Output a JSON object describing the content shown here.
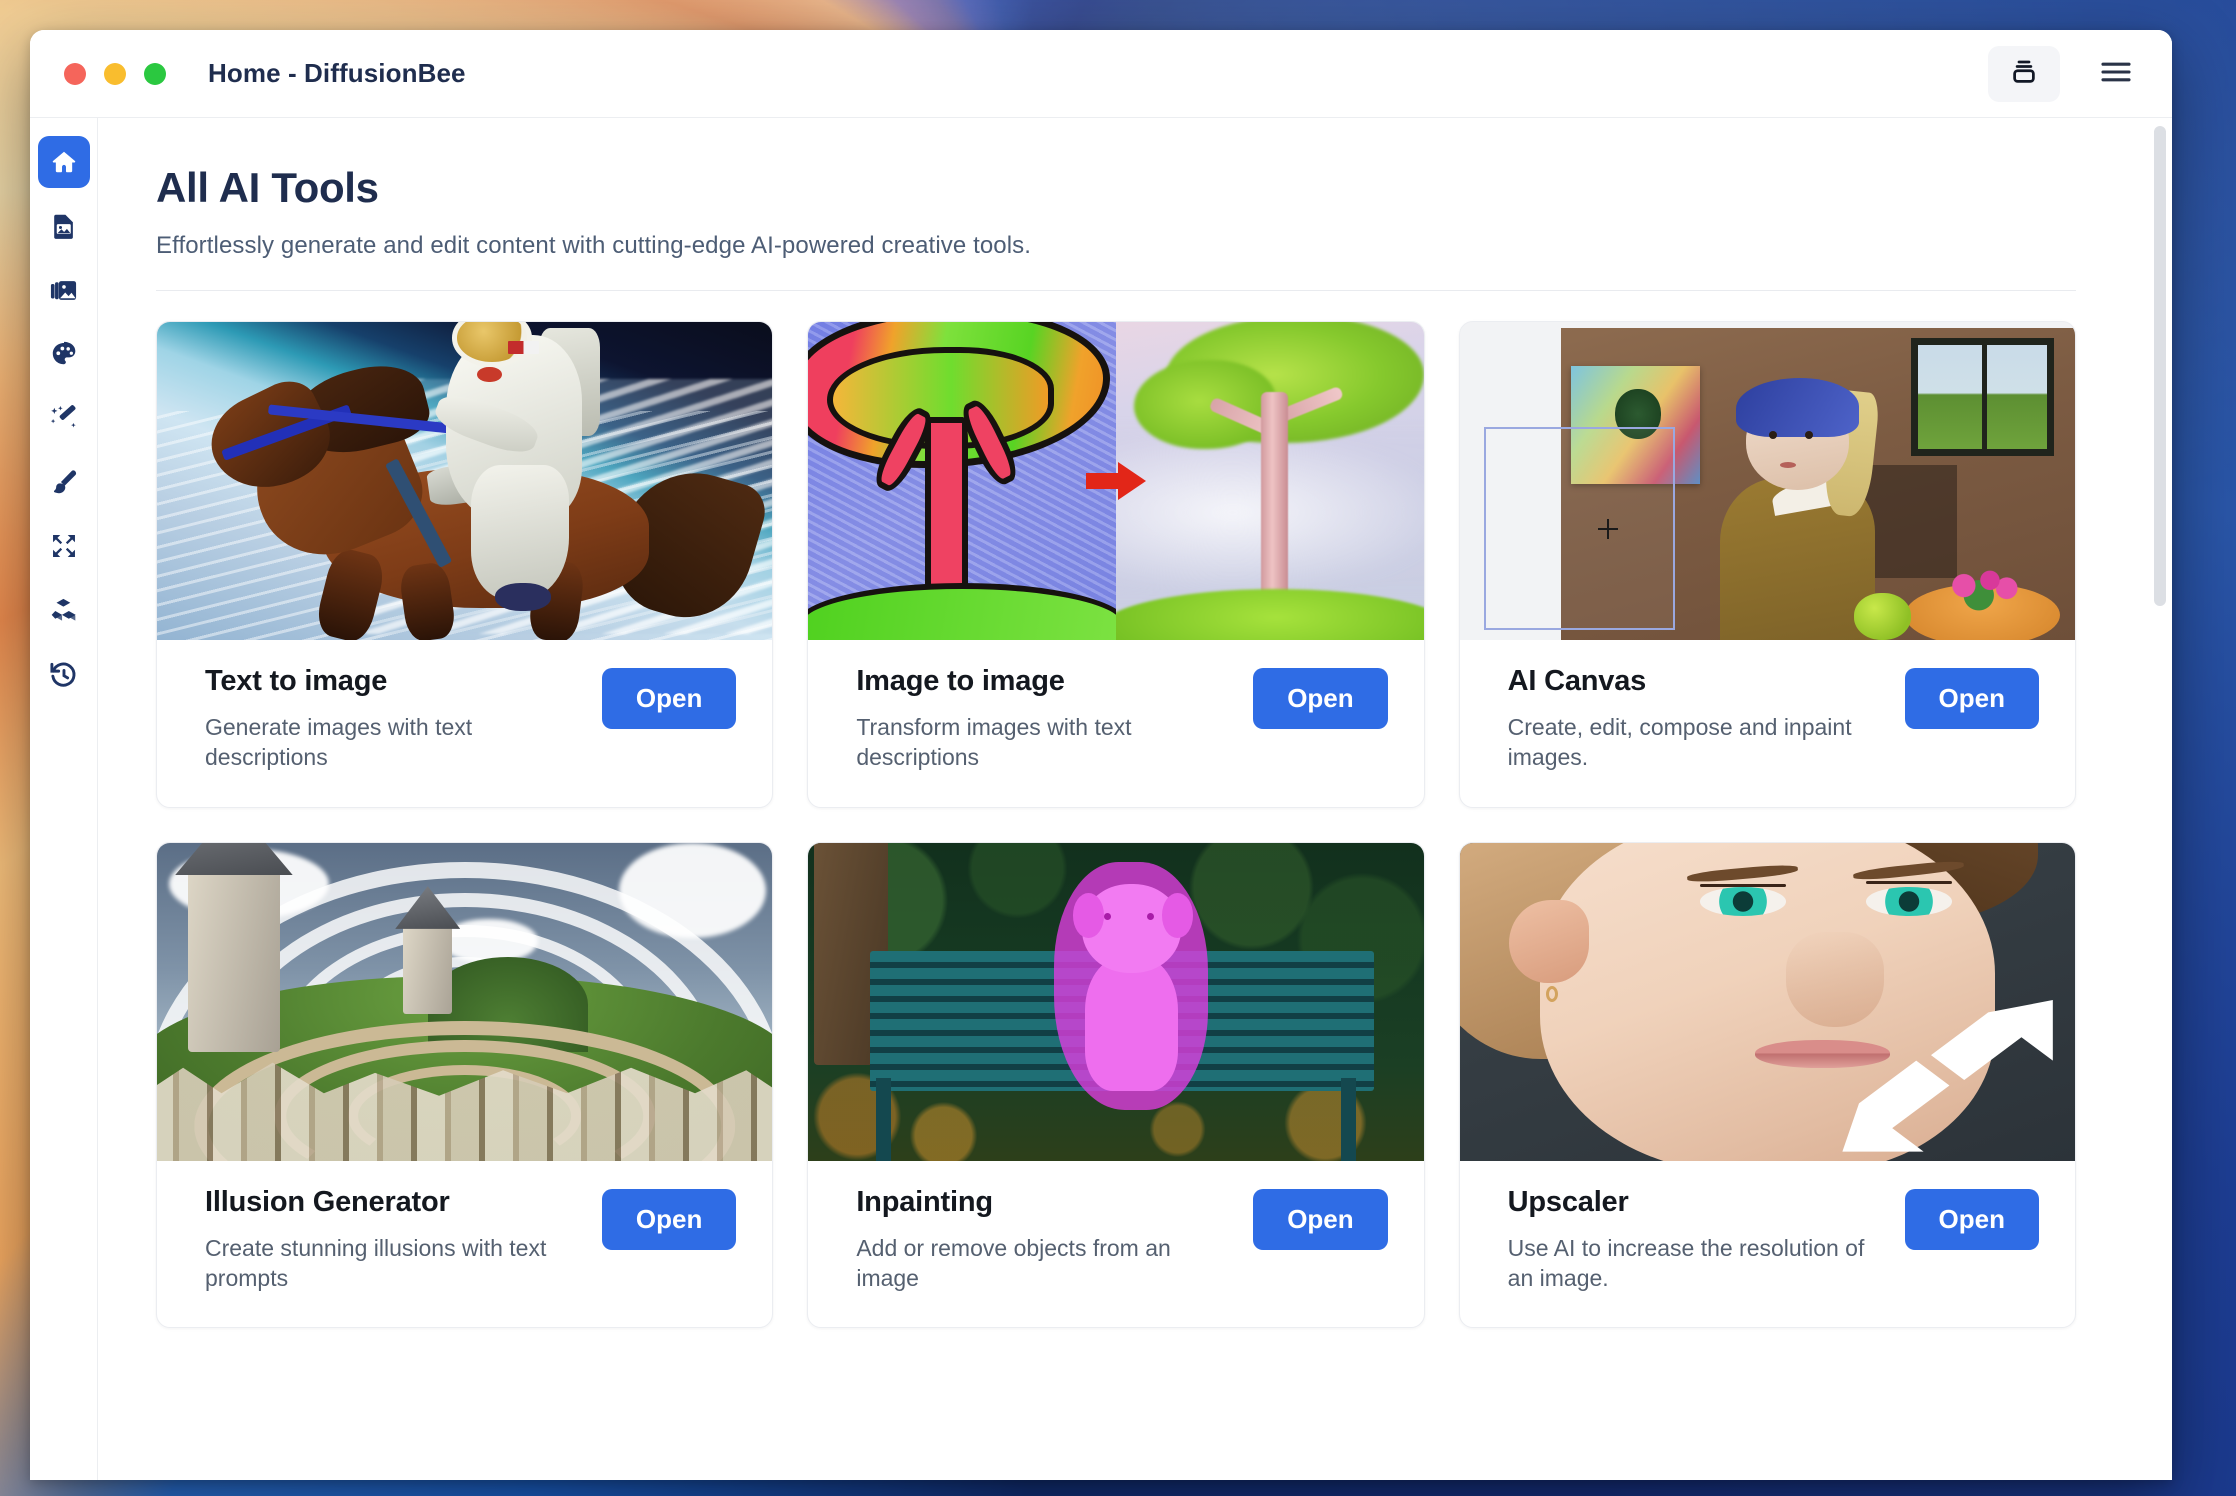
{
  "window": {
    "title": "Home - DiffusionBee",
    "traffic_lights": [
      "close",
      "minimize",
      "maximize"
    ],
    "layers_button_icon": "layers-stack-icon",
    "menu_button_icon": "hamburger-menu-icon"
  },
  "sidebar": {
    "items": [
      {
        "name": "home",
        "icon": "home-icon",
        "active": true
      },
      {
        "name": "text-to-image",
        "icon": "image-file-icon",
        "active": false
      },
      {
        "name": "gallery",
        "icon": "images-stack-icon",
        "active": false
      },
      {
        "name": "styles",
        "icon": "palette-icon",
        "active": false
      },
      {
        "name": "magic-edit",
        "icon": "magic-wand-icon",
        "active": false
      },
      {
        "name": "paint",
        "icon": "paintbrush-icon",
        "active": false
      },
      {
        "name": "upscale",
        "icon": "expand-arrows-icon",
        "active": false
      },
      {
        "name": "models",
        "icon": "blocks-cubes-icon",
        "active": false
      },
      {
        "name": "history",
        "icon": "history-clock-icon",
        "active": false
      }
    ]
  },
  "page": {
    "title": "All AI Tools",
    "subtitle": "Effortlessly generate and edit content with cutting-edge AI-powered creative tools."
  },
  "cards": [
    {
      "title": "Text to image",
      "description": "Generate images with text descriptions",
      "button_label": "Open",
      "thumbnail": "astronaut-riding-horse-in-space"
    },
    {
      "title": "Image to image",
      "description": "Transform images with text descriptions",
      "button_label": "Open",
      "thumbnail": "crayon-tree-to-realistic-tree"
    },
    {
      "title": "AI Canvas",
      "description": "Create, edit, compose and inpaint images.",
      "button_label": "Open",
      "thumbnail": "girl-with-pearl-earring-canvas"
    },
    {
      "title": "Illusion Generator",
      "description": "Create stunning illusions with text prompts",
      "button_label": "Open",
      "thumbnail": "spiral-medieval-village"
    },
    {
      "title": "Inpainting",
      "description": "Add or remove objects from an image",
      "button_label": "Open",
      "thumbnail": "dog-on-bench-with-mask"
    },
    {
      "title": "Upscaler",
      "description": "Use AI to increase the resolution of an image.",
      "button_label": "Open",
      "thumbnail": "woman-face-with-expand-arrows"
    }
  ],
  "colors": {
    "accent_blue": "#2f6ce5",
    "sidebar_icon": "#1f3566",
    "title_text": "#1f2d4e",
    "card_title": "#14181f",
    "card_desc": "#556070",
    "scrollbar": "#dcdfe4"
  },
  "scrollbar": {
    "visible": true
  }
}
